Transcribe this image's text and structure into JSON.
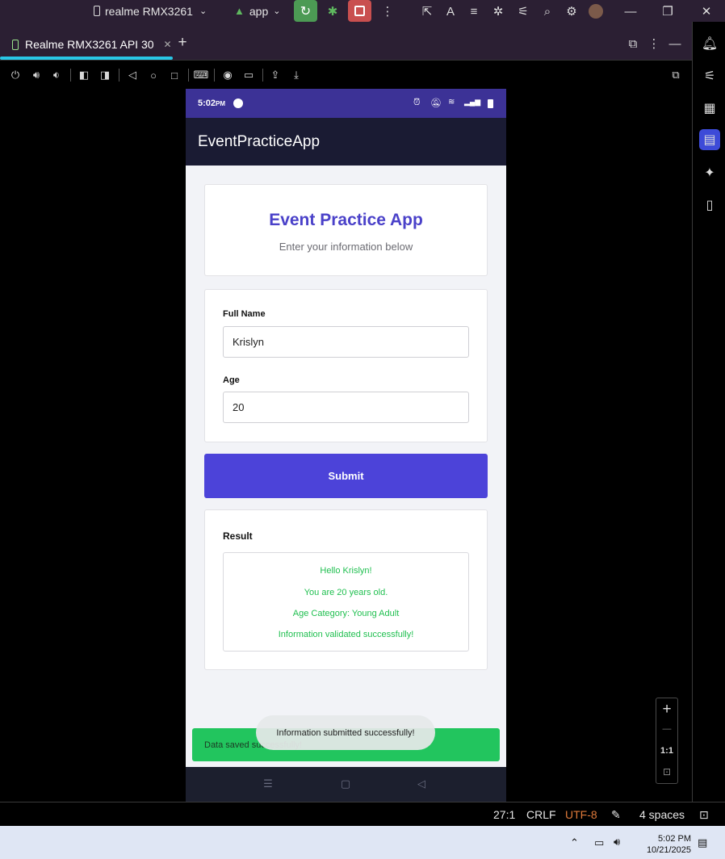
{
  "titlebar": {
    "device_selector": "realme RMX3261",
    "run_config": "app"
  },
  "tab": {
    "label": "Realme RMX3261 API 30"
  },
  "phone": {
    "status_time": "5:02",
    "status_ampm": "PM",
    "appbar_title": "EventPracticeApp",
    "header_card": {
      "title": "Event Practice App",
      "subtitle": "Enter your information below"
    },
    "form": {
      "name_label": "Full Name",
      "name_value": "Krislyn",
      "age_label": "Age",
      "age_value": "20"
    },
    "submit_label": "Submit",
    "result": {
      "heading": "Result",
      "lines": [
        "Hello Krislyn!",
        "You are 20 years old.",
        "Age Category: Young Adult",
        "Information validated successfully!"
      ]
    },
    "snackbar_text": "Data saved successfully!",
    "toast_text": "Information submitted successfully!"
  },
  "zoom": {
    "plus": "+",
    "minus": "—",
    "ratio": "1:1"
  },
  "ide_status": {
    "position": "27:1",
    "line_ending": "CRLF",
    "encoding": "UTF-8",
    "indent": "4 spaces"
  },
  "taskbar": {
    "time": "5:02 PM",
    "date": "10/21/2025"
  },
  "colors": {
    "accent": "#4c43d9",
    "title": "#4a41c9",
    "success": "#22c55e",
    "appbar": "#1a1b33",
    "statusbar": "#3c3296"
  }
}
